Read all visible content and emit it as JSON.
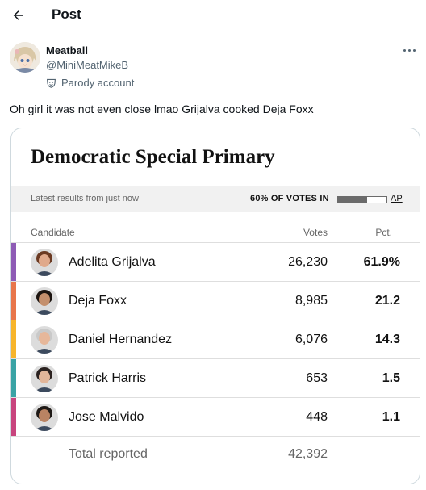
{
  "header": {
    "title": "Post",
    "back_icon": "arrow-left-icon"
  },
  "author": {
    "name": "Meatball",
    "handle": "@MiniMeatMikeB",
    "parody_label": "Parody account",
    "avatar_icon": "anime-avatar",
    "badge_icon": "parody-mask-icon"
  },
  "more_icon": "more-horizontal-icon",
  "tweet": {
    "text": "Oh girl it was not even close lmao Grijalva cooked Deja Foxx"
  },
  "card": {
    "title": "Democratic Special Primary",
    "results_label": "Latest results from just now",
    "votes_in": "60% OF VOTES IN",
    "votes_in_fraction": 0.6,
    "source": "AP",
    "columns": {
      "candidate": "Candidate",
      "votes": "Votes",
      "pct": "Pct."
    },
    "candidates": [
      {
        "name": "Adelita Grijalva",
        "votes": "26,230",
        "pct": "61.9%",
        "color": "#8e5bb5",
        "skin": "#e0a98b",
        "hair": "#6b3a22"
      },
      {
        "name": "Deja Foxx",
        "votes": "8,985",
        "pct": "21.2",
        "color": "#e8764b",
        "skin": "#c48f6c",
        "hair": "#1c1410"
      },
      {
        "name": "Daniel Hernandez",
        "votes": "6,076",
        "pct": "14.3",
        "color": "#f7b52c",
        "skin": "#e6b79a",
        "hair": "#c9c9c9"
      },
      {
        "name": "Patrick Harris",
        "votes": "653",
        "pct": "1.5",
        "color": "#3aa3a5",
        "skin": "#e2b69a",
        "hair": "#2b2220"
      },
      {
        "name": "Jose Malvido",
        "votes": "448",
        "pct": "1.1",
        "color": "#c8457e",
        "skin": "#b98363",
        "hair": "#1f1a17"
      }
    ],
    "total": {
      "label": "Total reported",
      "votes": "42,392"
    }
  }
}
